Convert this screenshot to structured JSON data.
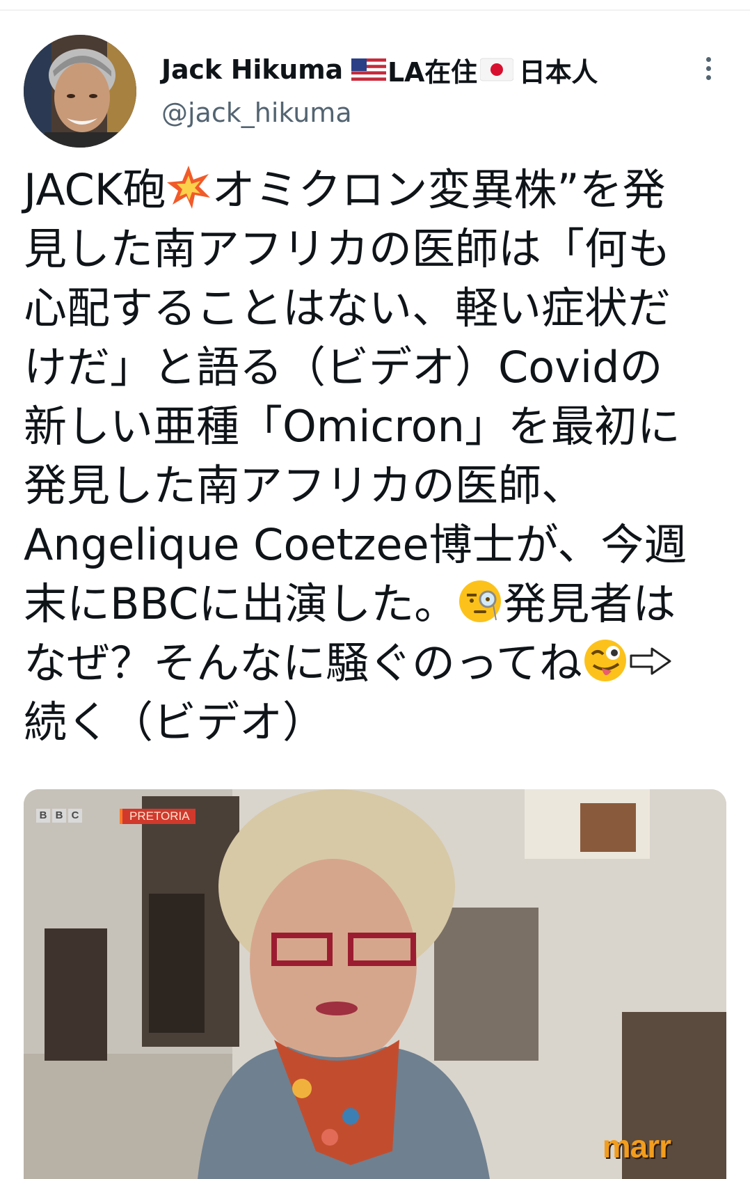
{
  "author": {
    "name": "Jack Hikuma",
    "location_text": "LA在住",
    "nationality_text": "日本人",
    "handle": "@jack_hikuma",
    "flags": [
      "us-flag-icon",
      "jp-flag-icon"
    ]
  },
  "tweet": {
    "lines": [
      [
        "JACK砲",
        "{collision}",
        "オミクロン変異株”を発"
      ],
      [
        "見した南アフリカの医師は「何も"
      ],
      [
        "心配することはない、軽い症状だ"
      ],
      [
        "けだ」と語る（ビデオ）Covidの"
      ],
      [
        "新しい亜種「Omicron」を最初に"
      ],
      [
        "発見した南アフリカの医師、"
      ],
      [
        "Angelique Coetzee博士が、今週"
      ],
      [
        "末にBBCに出演した。",
        "{monocle}",
        "発見者は"
      ],
      [
        "なぜ？そんなに騒ぐのってね",
        "{wink}",
        "{arrow}"
      ],
      [
        "続く（ビデオ）"
      ]
    ],
    "emojis": {
      "collision": "collision-emoji-icon",
      "monocle": "monocle-face-emoji-icon",
      "wink": "winking-face-tongue-emoji-icon",
      "arrow": "white-right-arrow-icon"
    }
  },
  "media": {
    "channel_logo_letters": [
      "B",
      "B",
      "C"
    ],
    "location_badge": "PRETORIA",
    "show_logo": "marr"
  },
  "colors": {
    "text": "#0f1419",
    "secondary": "#536471",
    "badge_red": "#d1392d",
    "marr_orange": "#f29d1e"
  }
}
